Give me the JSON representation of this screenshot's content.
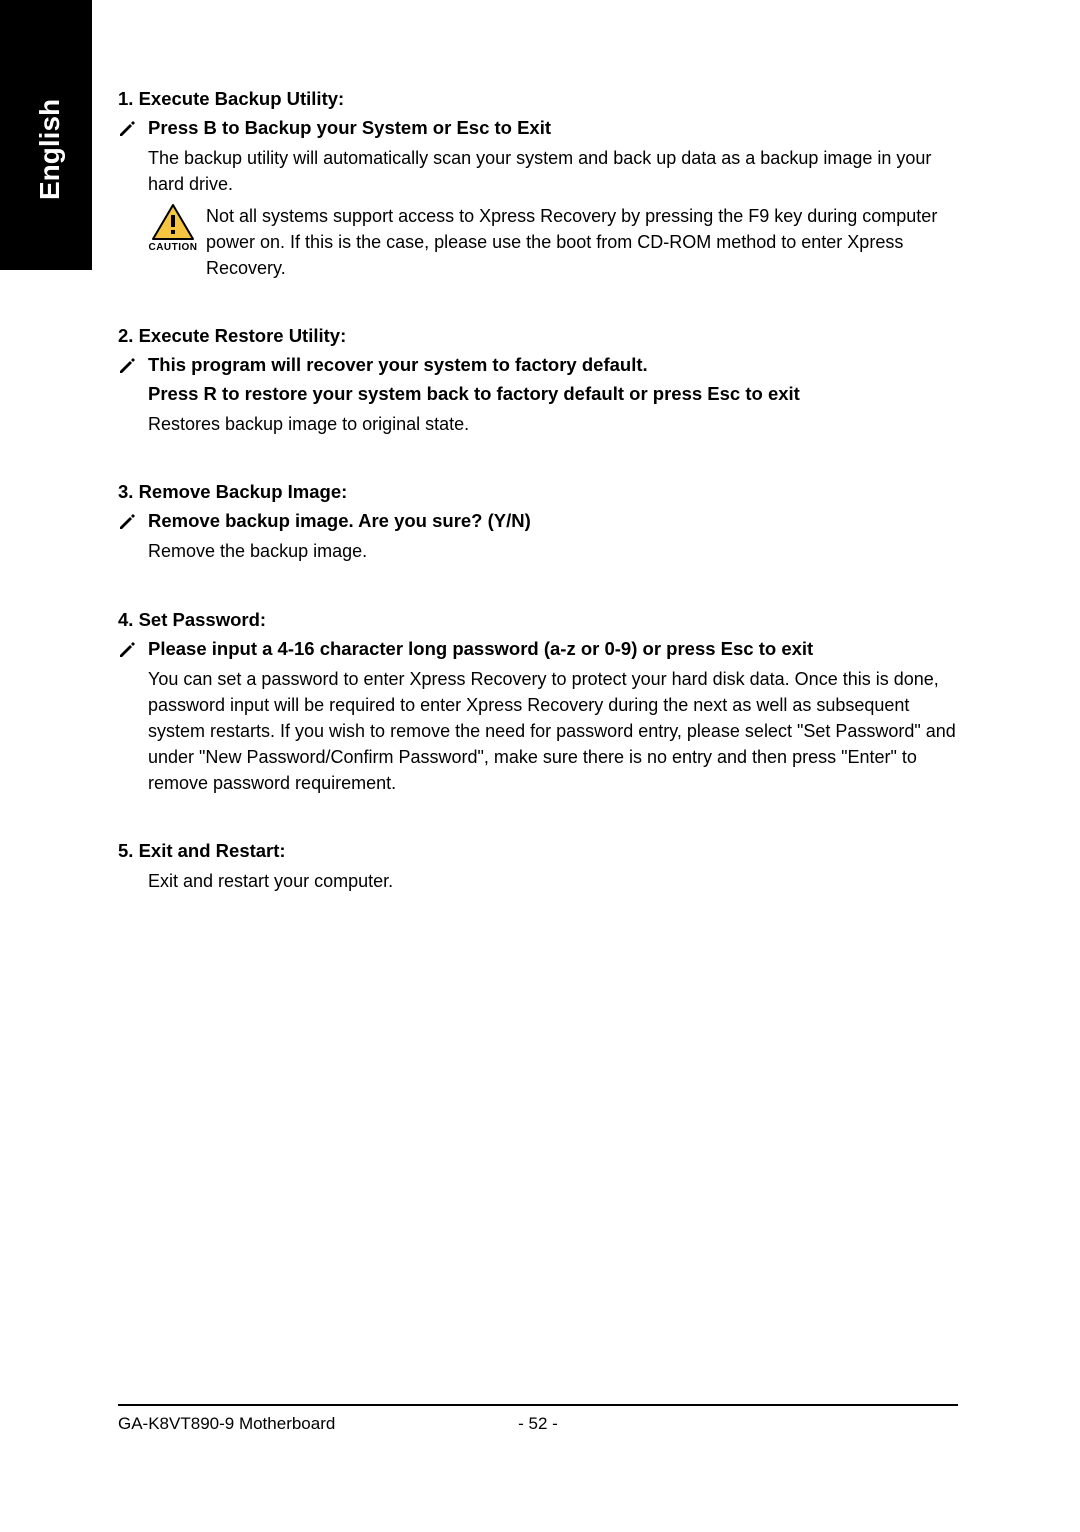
{
  "sideTab": "English",
  "sections": [
    {
      "heading": "1. Execute Backup Utility:",
      "subBold": [
        "Press B to Backup your System or Esc to Exit"
      ],
      "body": "The backup utility will automatically scan your system and back up data as a backup image in your hard drive.",
      "caution": {
        "label": "CAUTION",
        "text": "Not all systems support access to Xpress Recovery by pressing the F9 key during computer power on. If this is the case, please use the boot from CD-ROM method to enter Xpress Recovery."
      }
    },
    {
      "heading": "2. Execute Restore Utility:",
      "subBold": [
        "This program will recover your system to factory default.",
        "Press R to restore your system back to factory default or press Esc to exit"
      ],
      "body": "Restores backup image to original state."
    },
    {
      "heading": "3. Remove Backup Image:",
      "subBold": [
        "Remove backup image.  Are you sure?  (Y/N)"
      ],
      "body": "Remove the backup image."
    },
    {
      "heading": "4. Set Password:",
      "subBold": [
        "Please input a 4-16 character long password (a-z or 0-9) or press Esc to exit"
      ],
      "body": "You can set a password to enter Xpress Recovery to protect your hard disk data.  Once this is done, password input will be required to enter Xpress Recovery during the next as well as subsequent system restarts.  If you wish to remove the need for password entry, please select \"Set Password\" and under \"New Password/Confirm Password\", make sure there is no entry and then press \"Enter\" to remove password requirement."
    },
    {
      "heading": "5. Exit and Restart:",
      "bodyNoIndent": "Exit and restart your computer."
    }
  ],
  "footer": {
    "left": "GA-K8VT890-9 Motherboard",
    "center": "- 52 -"
  }
}
